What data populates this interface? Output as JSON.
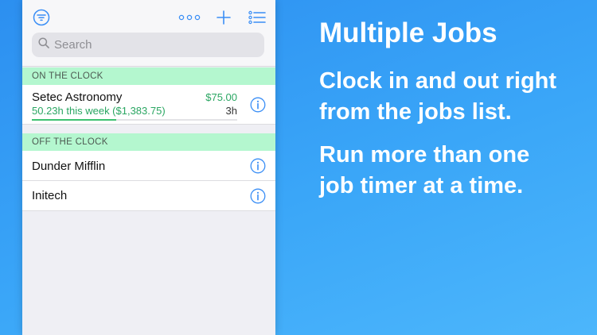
{
  "app": {
    "search": {
      "placeholder": "Search"
    },
    "sections": {
      "on_clock": "ON THE CLOCK",
      "off_clock": "OFF THE CLOCK"
    },
    "active_job": {
      "name": "Setec Astronomy",
      "amount": "$75.00",
      "week_summary": "50.23h this week ($1,383.75)",
      "hours": "3h",
      "progress": 0.41
    },
    "inactive_jobs": [
      {
        "name": "Dunder Mifflin"
      },
      {
        "name": "Initech"
      }
    ],
    "icons": {
      "filter": "filter-icon",
      "more": "more-icon",
      "add": "plus-icon",
      "list": "list-icon",
      "search": "search-icon",
      "info": "info-icon"
    },
    "colors": {
      "accent": "#3a8ef6",
      "money": "#2aa662",
      "section_bg": "#b4f7cf",
      "background": "#2c8ff0"
    }
  },
  "promo": {
    "title": "Multiple Jobs",
    "line1": "Clock in and out right",
    "line2": "from the jobs list.",
    "line3": "Run more than one",
    "line4": "job timer at a time."
  }
}
